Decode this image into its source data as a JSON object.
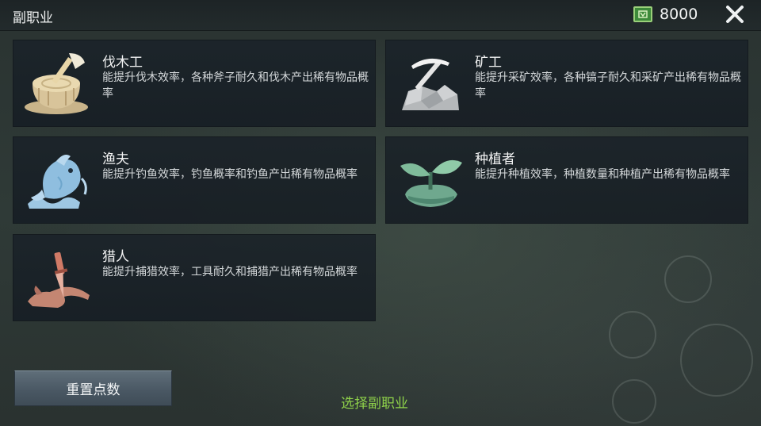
{
  "header": {
    "title": "副职业",
    "currency": {
      "value": "8000",
      "icon": "cash-icon",
      "color": "#3d8a3a"
    }
  },
  "professions": [
    {
      "name": "伐木工",
      "desc": "能提升伐木效率，各种斧子耐久和伐木产出稀有物品概率",
      "icon": "axe-stump-icon"
    },
    {
      "name": "矿工",
      "desc": "能提升采矿效率，各种镐子耐久和采矿产出稀有物品概率",
      "icon": "pickaxe-rock-icon"
    },
    {
      "name": "渔夫",
      "desc": "能提升钓鱼效率，钓鱼概率和钓鱼产出稀有物品概率",
      "icon": "fish-icon"
    },
    {
      "name": "种植者",
      "desc": "能提升种植效率，种植数量和种植产出稀有物品概率",
      "icon": "sprout-icon"
    },
    {
      "name": "猎人",
      "desc": "能提升捕猎效率，工具耐久和捕猎产出稀有物品概率",
      "icon": "hunting-knife-icon"
    }
  ],
  "footer": {
    "reset_label": "重置点数",
    "hint": "选择副职业",
    "hint_color": "#8fd24a"
  }
}
